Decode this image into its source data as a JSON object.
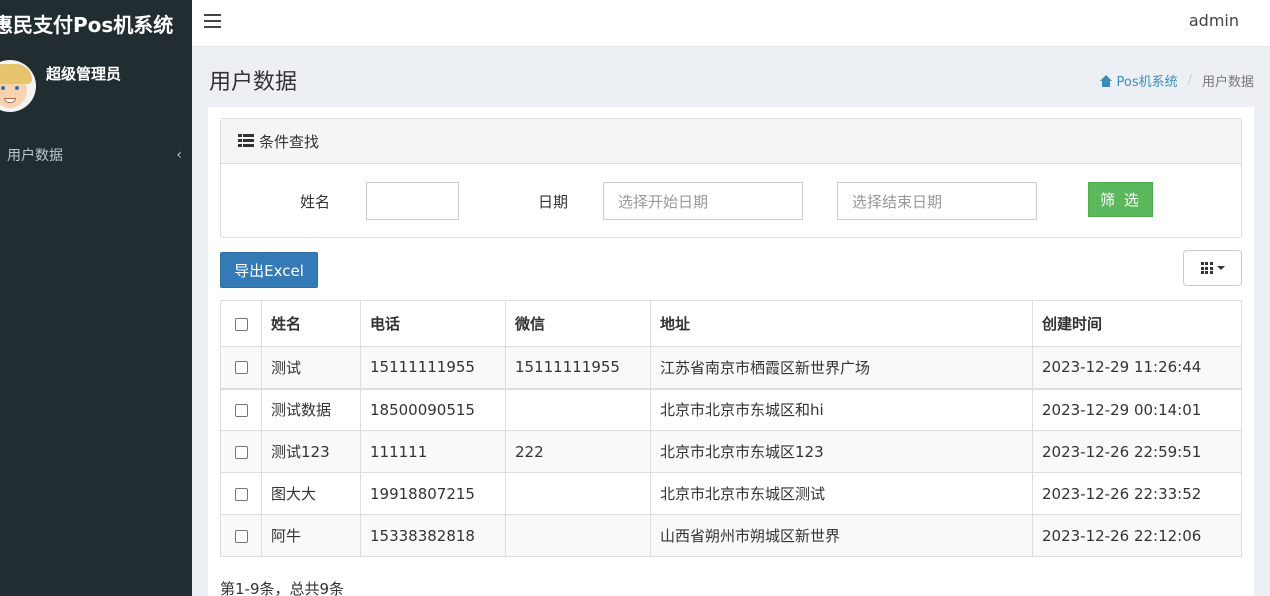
{
  "app": {
    "title": "惠民支付Pos机系统",
    "user_name": "超级管理员",
    "admin_label": "admin"
  },
  "sidebar": {
    "items": [
      {
        "label": "用户数据",
        "icon": "chevron-left-icon"
      }
    ]
  },
  "page": {
    "title": "用户数据",
    "breadcrumb": [
      {
        "label": "Pos机系统",
        "icon": "home-icon"
      },
      {
        "label": "用户数据"
      }
    ]
  },
  "search": {
    "heading": "条件查找",
    "name_label": "姓名",
    "name_value": "",
    "date_label": "日期",
    "start_placeholder": "选择开始日期",
    "end_placeholder": "选择结束日期",
    "filter_button": "筛 选"
  },
  "toolbar": {
    "export_label": "导出Excel",
    "columns_icon": "grid-icon"
  },
  "table": {
    "headers": [
      "姓名",
      "电话",
      "微信",
      "地址",
      "创建时间"
    ],
    "rows": [
      [
        "测试",
        "15111111955",
        "15111111955",
        "江苏省南京市栖霞区新世界广场",
        "2023-12-29 11:26:44"
      ],
      [
        "测试数据",
        "18500090515",
        "",
        "北京市北京市东城区和hi",
        "2023-12-29 00:14:01"
      ],
      [
        "测试123",
        "111111",
        "222",
        "北京市北京市东城区123",
        "2023-12-26 22:59:51"
      ],
      [
        "图大大",
        "19918807215",
        "",
        "北京市北京市东城区测试",
        "2023-12-26 22:33:52"
      ],
      [
        "阿牛",
        "15338382818",
        "",
        "山西省朔州市朔城区新世界",
        "2023-12-26 22:12:06"
      ]
    ]
  },
  "pagination": {
    "info": "第1-9条，总共9条"
  },
  "colors": {
    "sidebar_bg": "#222d32",
    "primary": "#337ab7",
    "success": "#5cb85c",
    "link": "#3c8dbc"
  }
}
